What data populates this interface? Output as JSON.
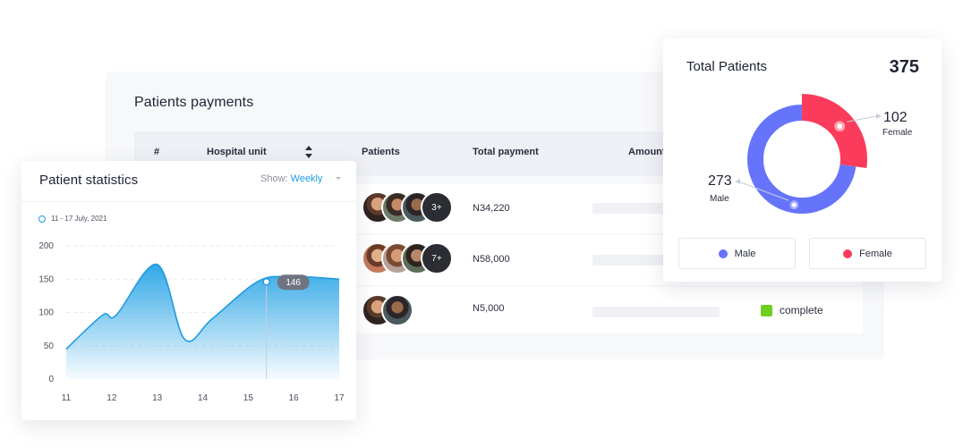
{
  "payments": {
    "title": "Patients payments",
    "columns": [
      "#",
      "Hospital unit",
      "Patients",
      "Total payment",
      "Amount"
    ],
    "rows": [
      {
        "patients_extra": "3+",
        "total_payment": "N34,220",
        "status": ""
      },
      {
        "patients_extra": "7+",
        "total_payment": "N58,000",
        "status": ""
      },
      {
        "patients_extra": "",
        "total_payment": "N5,000",
        "status": "complete"
      }
    ],
    "status_color": "#6fcf20"
  },
  "statistics": {
    "title": "Patient statistics",
    "show_label": "Show:",
    "show_value": "Weekly",
    "date_range": "11 - 17 July, 2021",
    "tooltip_value": "146",
    "y_ticks": [
      "0",
      "50",
      "100",
      "150",
      "200"
    ],
    "x_ticks": [
      "11",
      "12",
      "13",
      "14",
      "15",
      "16",
      "17"
    ],
    "accent": "#1e9be0"
  },
  "chart_data": {
    "type": "area",
    "x": [
      11,
      11.8,
      12.1,
      13,
      13.6,
      14.2,
      15.2,
      15.9,
      17
    ],
    "values": [
      45,
      96,
      96,
      172,
      60,
      90,
      146,
      154,
      150
    ],
    "ylim": [
      0,
      200
    ],
    "xlim": [
      11,
      17
    ],
    "highlight": {
      "x": 15.4,
      "y": 146
    },
    "grid": true
  },
  "total": {
    "title": "Total Patients",
    "count": "375",
    "male_count": "273",
    "male_label": "Male",
    "female_count": "102",
    "female_label": "Female",
    "legend_male": "Male",
    "legend_female": "Female",
    "male_color": "#6674fb",
    "female_color": "#fb3b5b"
  }
}
